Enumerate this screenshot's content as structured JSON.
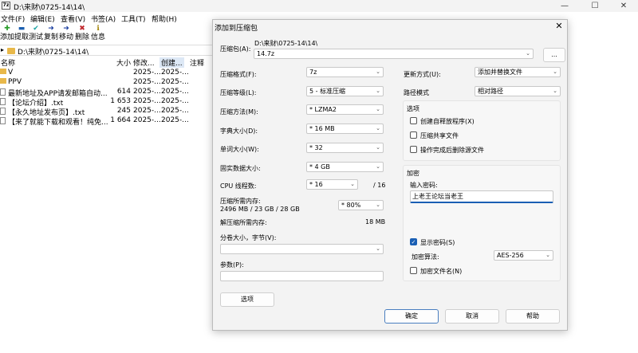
{
  "window": {
    "title": "D:\\来财\\0725-14\\14\\",
    "app_icon": "7z",
    "minimize": "—",
    "maximize": "☐",
    "close": "✕"
  },
  "menu": [
    "文件(F)",
    "编辑(E)",
    "查看(V)",
    "书签(A)",
    "工具(T)",
    "帮助(H)"
  ],
  "toolbar": [
    {
      "label": "添加",
      "icon": "plus-icon",
      "glyph": "✚",
      "color": "#2a9d2a"
    },
    {
      "label": "提取",
      "icon": "minus-icon",
      "glyph": "▬",
      "color": "#1b5fb0"
    },
    {
      "label": "测试",
      "icon": "check-icon",
      "glyph": "✔",
      "color": "#1aa3a3"
    },
    {
      "label": "复制",
      "icon": "copy-arrow-icon",
      "glyph": "➜",
      "color": "#1b3fa0"
    },
    {
      "label": "移动",
      "icon": "move-arrow-icon",
      "glyph": "➜",
      "color": "#1b3fa0"
    },
    {
      "label": "删除",
      "icon": "delete-icon",
      "glyph": "✖",
      "color": "#c0282d"
    },
    {
      "label": "信息",
      "icon": "info-icon",
      "glyph": "ℹ",
      "color": "#a08000"
    }
  ],
  "address": {
    "path": "D:\\来财\\0725-14\\14\\"
  },
  "columns": {
    "name": "名称",
    "size": "大小",
    "modified": "修改...",
    "created": "创建...",
    "comment": "注释"
  },
  "files": [
    {
      "type": "folder",
      "name": "V",
      "size": "",
      "modified": "2025-...",
      "created": "2025-..."
    },
    {
      "type": "folder",
      "name": "PPV",
      "size": "",
      "modified": "2025-...",
      "created": "2025-..."
    },
    {
      "type": "txt",
      "name": "最新地址及APP请发邮箱自动...",
      "size": "614",
      "modified": "2025-...",
      "created": "2025-..."
    },
    {
      "type": "txt",
      "name": "【论坛介绍】.txt",
      "size": "1 653",
      "modified": "2025-...",
      "created": "2025-..."
    },
    {
      "type": "txt",
      "name": "【永久地址发布页】.txt",
      "size": "245",
      "modified": "2025-...",
      "created": "2025-..."
    },
    {
      "type": "txt",
      "name": "【来了就能下载和观看！纯免...",
      "size": "1 664",
      "modified": "2025-...",
      "created": "2025-..."
    }
  ],
  "dialog": {
    "title": "添加到压缩包",
    "close": "✕",
    "archive_label": "压缩包(A):",
    "archive_path": "D:\\来财\\0725-14\\14\\",
    "archive_name": "14.7z",
    "browse_label": "...",
    "format_label": "压缩格式(F):",
    "format_value": "7z",
    "level_label": "压缩等级(L):",
    "level_value": "5 - 标准压缩",
    "method_label": "压缩方法(M):",
    "method_value": "* LZMA2",
    "dict_label": "字典大小(D):",
    "dict_value": "* 16 MB",
    "word_label": "单词大小(W):",
    "word_value": "* 32",
    "solid_label": "固实数据大小:",
    "solid_value": "* 4 GB",
    "cpu_label": "CPU 线程数:",
    "cpu_value": "* 16",
    "cpu_total": "/ 16",
    "mem_label": "压缩所需内存:",
    "mem_value": "2496 MB / 23 GB / 28 GB",
    "mem_percent": "* 80%",
    "decomp_label": "解压缩所需内存:",
    "decomp_value": "18 MB",
    "split_label": "分卷大小，字节(V):",
    "split_value": "",
    "params_label": "参数(P):",
    "params_value": "",
    "options_button": "选项",
    "update_label": "更新方式(U):",
    "update_value": "添加并替换文件",
    "pathmode_label": "路径模式",
    "pathmode_value": "相对路径",
    "options_group": "选项",
    "opt_sfx": "创建自释放程序(X)",
    "opt_shared": "压缩共享文件",
    "opt_delete": "操作完成后删除源文件",
    "encrypt_group": "加密",
    "password_label": "输入密码:",
    "password_value": "上老王论坛当老王",
    "show_password": "显示密码(S)",
    "enc_method_label": "加密算法:",
    "enc_method_value": "AES-256",
    "encrypt_names": "加密文件名(N)",
    "ok": "确定",
    "cancel": "取消",
    "help": "帮助"
  }
}
